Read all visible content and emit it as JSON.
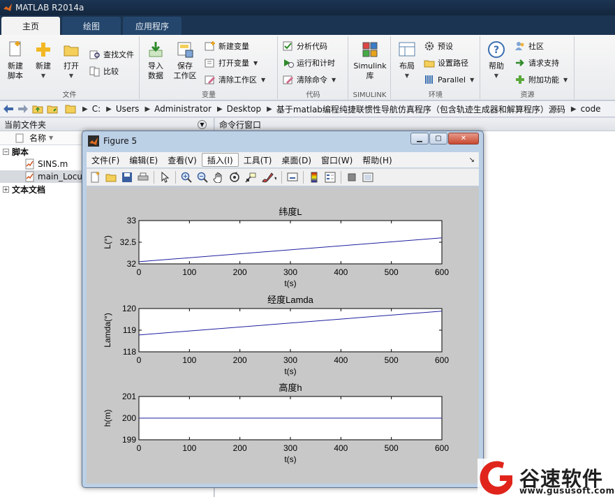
{
  "app": {
    "title": "MATLAB R2014a"
  },
  "ribbon_tabs": [
    {
      "label": "主页",
      "active": true
    },
    {
      "label": "绘图",
      "active": false
    },
    {
      "label": "应用程序",
      "active": false
    }
  ],
  "ribbon": {
    "file_group": {
      "label": "文件",
      "new_script": "新建\n脚本",
      "new": "新建",
      "open": "打开",
      "find_files": "查找文件",
      "compare": "比较"
    },
    "variable_group": {
      "label": "变量",
      "import": "导入\n数据",
      "save_ws": "保存\n工作区",
      "new_var": "新建变量",
      "open_var": "打开变量",
      "clear_ws": "清除工作区"
    },
    "code_group": {
      "label": "代码",
      "analyze": "分析代码",
      "run_time": "运行和计时",
      "clear_cmd": "清除命令"
    },
    "simulink_group": {
      "label": "SIMULINK",
      "simulink": "Simulink\n库"
    },
    "env_group": {
      "label": "环境",
      "layout": "布局",
      "prefs": "预设",
      "set_path": "设置路径",
      "parallel": "Parallel"
    },
    "resources_group": {
      "label": "资源",
      "help": "帮助",
      "community": "社区",
      "support": "请求支持",
      "addons": "附加功能"
    }
  },
  "address": {
    "crumbs": [
      "C:",
      "Users",
      "Administrator",
      "Desktop",
      "基于matlab编程纯捷联惯性导航仿真程序（包含轨迹生成器和解算程序）源码",
      "code"
    ]
  },
  "left_panel": {
    "title": "当前文件夹",
    "column": "名称",
    "tree": [
      {
        "label": "脚本",
        "type": "group",
        "expander": "-"
      },
      {
        "label": "SINS.m",
        "type": "file"
      },
      {
        "label": "main_Locus.m",
        "type": "file",
        "selected": true
      },
      {
        "label": "文本文档",
        "type": "group",
        "expander": "+"
      }
    ]
  },
  "right_panel": {
    "title": "命令行窗口"
  },
  "figure": {
    "title": "Figure 5",
    "menus": [
      "文件(F)",
      "编辑(E)",
      "查看(V)",
      "插入(I)",
      "工具(T)",
      "桌面(D)",
      "窗口(W)",
      "帮助(H)"
    ],
    "menu_hover": "插入(I)"
  },
  "colors": {
    "line": "#1f1f9e",
    "figure_bg": "#c8c8c8",
    "accent": "#1b3451"
  },
  "chart_data": [
    {
      "type": "line",
      "title": "纬度L",
      "xlabel": "t(s)",
      "ylabel": "L(°)",
      "xlim": [
        0,
        600
      ],
      "ylim": [
        32,
        33
      ],
      "xticks": [
        0,
        100,
        200,
        300,
        400,
        500,
        600
      ],
      "yticks": [
        32,
        32.5,
        33
      ],
      "series": [
        {
          "x": [
            0,
            600
          ],
          "y": [
            32.05,
            32.6
          ]
        }
      ]
    },
    {
      "type": "line",
      "title": "经度Lamda",
      "xlabel": "t(s)",
      "ylabel": "Lamda(°)",
      "xlim": [
        0,
        600
      ],
      "ylim": [
        118,
        120
      ],
      "xticks": [
        0,
        100,
        200,
        300,
        400,
        500,
        600
      ],
      "yticks": [
        118,
        119,
        120
      ],
      "series": [
        {
          "x": [
            0,
            600
          ],
          "y": [
            118.78,
            119.88
          ]
        }
      ]
    },
    {
      "type": "line",
      "title": "高度h",
      "xlabel": "t(s)",
      "ylabel": "h(m)",
      "xlim": [
        0,
        600
      ],
      "ylim": [
        199,
        201
      ],
      "xticks": [
        0,
        100,
        200,
        300,
        400,
        500,
        600
      ],
      "yticks": [
        199,
        200,
        201
      ],
      "series": [
        {
          "x": [
            0,
            600
          ],
          "y": [
            200,
            200
          ]
        }
      ]
    }
  ],
  "watermark": {
    "brand": "谷速软件",
    "url": "www.gususoft.com"
  }
}
